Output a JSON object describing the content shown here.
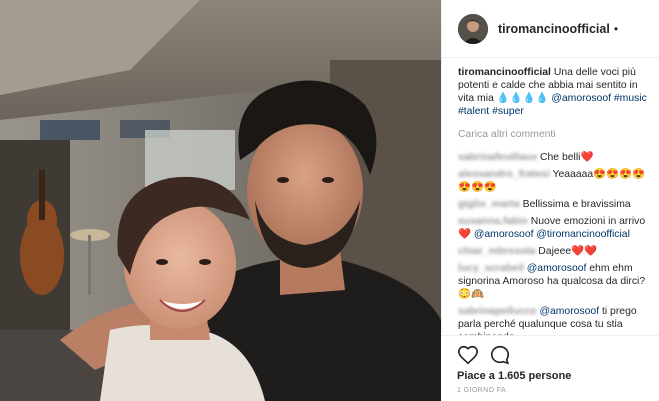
{
  "post": {
    "username": "tiromancinoofficial",
    "follow_dot": "•",
    "caption_user": "tiromancinoofficial",
    "caption_text": "Una delle voci più potenti e calde che abbia mai sentito in vita mia",
    "caption_drops": "💧💧💧💧",
    "caption_tags": [
      "@amorosoof",
      "#music",
      "#talent",
      "#super"
    ],
    "load_more": "Carica altri commenti"
  },
  "comments": [
    {
      "user": "sabrinafeuillaux",
      "text": "Che belli❤️"
    },
    {
      "user": "alessandro_fratesi",
      "text": "Yeaaaaa😍😍😍😍😍😍😍"
    },
    {
      "user": "giglio_marta",
      "text": "Bellissima e bravissima"
    },
    {
      "user": "susanna.fabio",
      "text": "Nuove emozioni in arrivo❤️",
      "mentions": "@amorosoof @tiromancinoofficial"
    },
    {
      "user": "chiar_mbrosola",
      "text": "Dajeee❤️❤️"
    },
    {
      "user": "lucy_scrabeil",
      "mention": "@amorosoof",
      "text": "ehm ehm signorina Amoroso ha qualcosa da dirci?😳🙉"
    },
    {
      "user": "sabrinapellucce",
      "mention": "@amorosoof",
      "text": "ti prego parla perché qualunque cosa tu stia combinando"
    }
  ],
  "footer": {
    "likes": "Piace a 1.605 persone",
    "time": "1 GIORNO FA"
  },
  "icons": {
    "like": "heart-icon",
    "comment": "comment-icon"
  }
}
